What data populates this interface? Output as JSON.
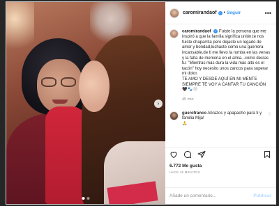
{
  "post": {
    "username": "caromirandaof",
    "follow_label": "Seguir",
    "more_label": "•••",
    "caption": "Fuiste la persona que me inspiró a que la familia significa unión,te nos fuiste chaparrita pero dejaste un legado de amor y bondad,luchaste como una guerrera incansable,de ti me llevo la rumba en las venas y la falta de memoria en el alma...cómo decías tu: \"Mientras más dura la vida más alto es el tacón\" hoy necesito unos zancos para superar mi dolor.",
    "caption_extra": "TE AMO Y DESDE AQUÍ EN MI MENTE SIEMPRE TE VOY A CANTAR TU CANCIÓN 🖤🐾🤍",
    "caption_time": "45 min",
    "comment": {
      "username": "guerofranco",
      "text": "Abrazos y apapacho para ti y familia Mija!",
      "emoji": "🙏"
    },
    "views": "6.772 Me gusta",
    "time_ago": "HACE 45 MINUTOS",
    "add_comment_placeholder": "Añade un comentario...",
    "publish_label": "Publicar",
    "carousel": {
      "count": 2,
      "active": 0
    }
  },
  "icons": [
    "heart-icon",
    "comment-icon",
    "share-icon",
    "bookmark-icon",
    "more-icon",
    "verified-icon",
    "next-arrow-icon"
  ],
  "colors": {
    "link": "#3897f0",
    "publish_disabled": "#b3dbff",
    "muted": "#8e8e8e",
    "text": "#262626"
  }
}
